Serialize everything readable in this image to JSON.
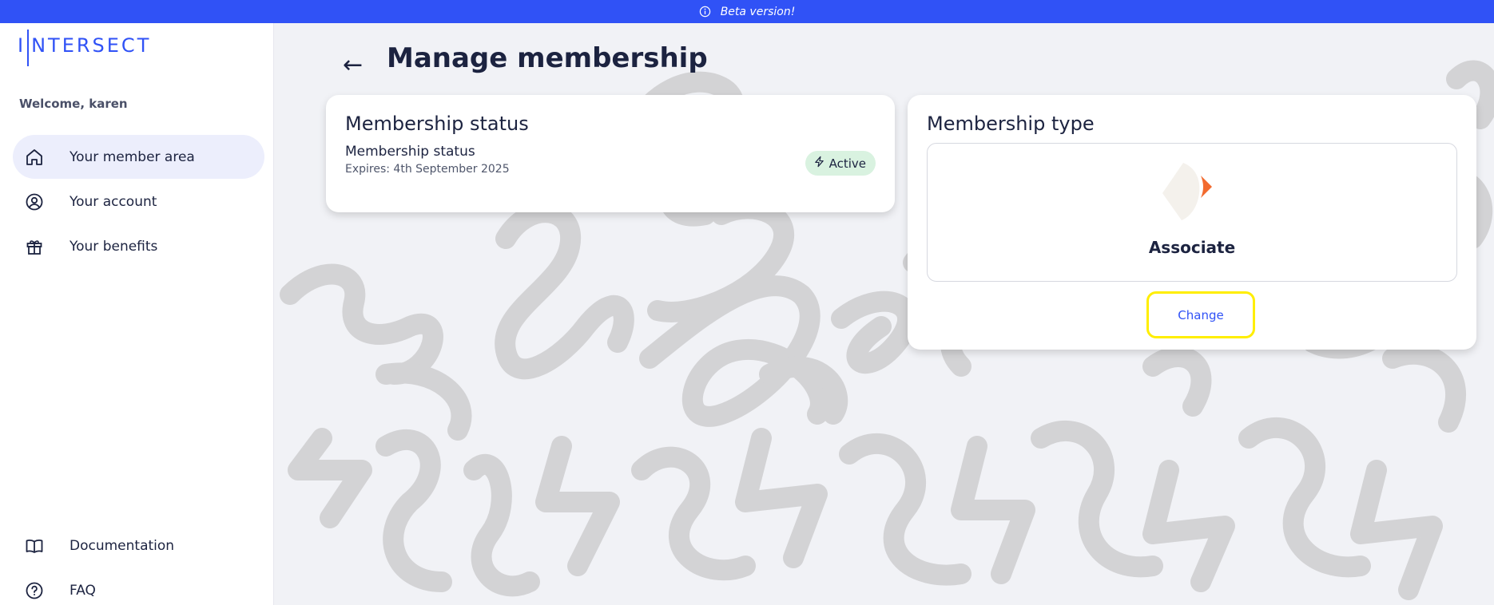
{
  "banner": {
    "text": "Beta version!",
    "icon": "info-icon"
  },
  "sidebar": {
    "logo_text": "INTERSECT",
    "welcome": "Welcome, karen",
    "items": [
      {
        "label": "Your member area",
        "icon": "home-icon",
        "active": true
      },
      {
        "label": "Your account",
        "icon": "user-circle-icon",
        "active": false
      },
      {
        "label": "Your benefits",
        "icon": "gift-icon",
        "active": false
      }
    ],
    "footer_items": [
      {
        "label": "Documentation",
        "icon": "book-icon"
      },
      {
        "label": "FAQ",
        "icon": "help-circle-icon"
      }
    ]
  },
  "header": {
    "back_icon": "arrow-left-icon",
    "title": "Manage membership"
  },
  "status_card": {
    "title": "Membership status",
    "label": "Membership status",
    "expires": "Expires: 4th September 2025",
    "badge": "Active",
    "badge_icon": "lightning-icon"
  },
  "type_card": {
    "title": "Membership type",
    "type_name": "Associate",
    "change_label": "Change"
  },
  "colors": {
    "accent": "#3052f6",
    "badge_bg": "#d9f2e0",
    "highlight": "#ffee00",
    "logo_orange": "#f26a2e"
  }
}
